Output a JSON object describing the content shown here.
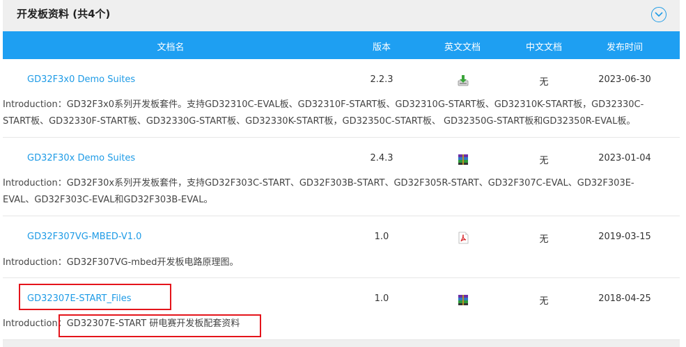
{
  "section": {
    "title": "开发板资料 (共4个)",
    "collapse_icon": "chevron-down-circle-icon"
  },
  "columns": {
    "name": "文档名",
    "version": "版本",
    "english_doc": "英文文档",
    "chinese_doc": "中文文档",
    "release_date": "发布时间"
  },
  "rows": [
    {
      "name": "GD32F3x0 Demo Suites",
      "version": "2.2.3",
      "english_doc_icon": "download-icon",
      "chinese_doc": "无",
      "date": "2023-06-30",
      "intro_line1": "Introduction：GD32F3x0系列开发板套件。支持GD32310C-EVAL板、GD32310F-START板、GD32310G-START板、GD32310K-START板，GD32330C-",
      "intro_line2": "START板、GD32330F-START板、GD32330G-START板、GD32330K-START板，GD32350C-START板、 GD32350G-START板和GD32350R-EVAL板。"
    },
    {
      "name": "GD32F30x Demo Suites",
      "version": "2.4.3",
      "english_doc_icon": "archive-icon",
      "chinese_doc": "无",
      "date": "2023-01-04",
      "intro_line1": "Introduction：GD32F30x系列开发板套件，支持GD32F303C-START、GD32F303B-START、GD32F305R-START、GD32F307C-EVAL、GD32F303E-",
      "intro_line2": "EVAL、GD32F303C-EVAL和GD32F303B-EVAL。"
    },
    {
      "name": "GD32F307VG-MBED-V1.0",
      "version": "1.0",
      "english_doc_icon": "pdf-icon",
      "chinese_doc": "无",
      "date": "2019-03-15",
      "intro_label": "Introduction：",
      "intro_text": "GD32F307VG-mbed开发板电路原理图。"
    },
    {
      "name": "GD32307E-START_Files",
      "version": "1.0",
      "english_doc_icon": "archive-icon",
      "chinese_doc": "无",
      "date": "2018-04-25",
      "intro_label": "Introduction：",
      "intro_text": "GD32307E-START 研电赛开发板配套资料"
    }
  ],
  "colors": {
    "header_blue": "#1e9ff2",
    "link_blue": "#1e9be6",
    "highlight_red": "#e4141b",
    "panel_gray": "#efefef"
  }
}
